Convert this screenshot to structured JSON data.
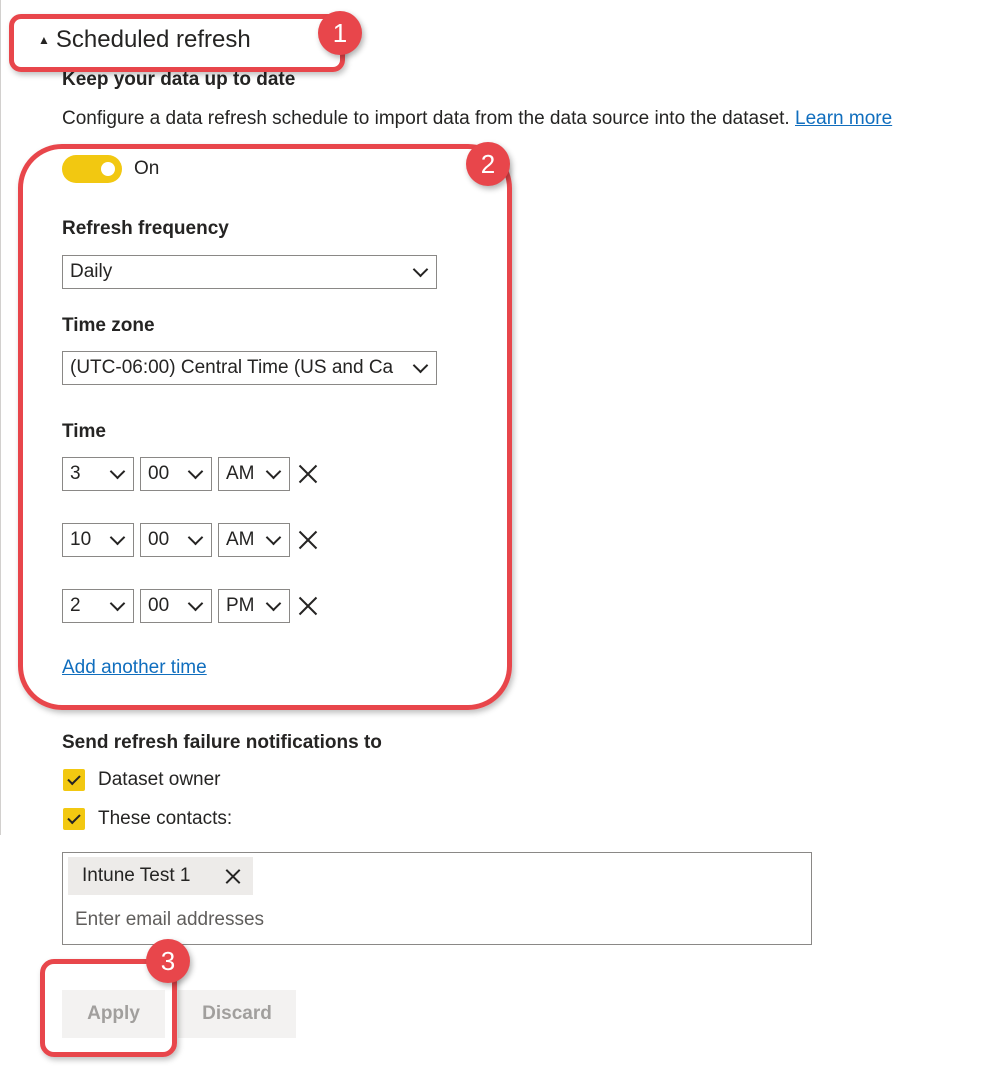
{
  "section": {
    "title": "Scheduled refresh",
    "toggle_glyph": "▲"
  },
  "intro": {
    "heading": "Keep your data up to date",
    "description": "Configure a data refresh schedule to import data from the data source into the dataset.",
    "learn_more": "Learn more"
  },
  "toggle": {
    "state": "On",
    "on": true
  },
  "frequency": {
    "label": "Refresh frequency",
    "value": "Daily"
  },
  "timezone": {
    "label": "Time zone",
    "value": "(UTC-06:00) Central Time (US and Ca"
  },
  "time": {
    "label": "Time",
    "rows": [
      {
        "hour": "3",
        "minute": "00",
        "period": "AM"
      },
      {
        "hour": "10",
        "minute": "00",
        "period": "AM"
      },
      {
        "hour": "2",
        "minute": "00",
        "period": "PM"
      }
    ],
    "add_another": "Add another time"
  },
  "notifications": {
    "label": "Send refresh failure notifications to",
    "dataset_owner": {
      "label": "Dataset owner",
      "checked": true
    },
    "these_contacts": {
      "label": "These contacts:",
      "checked": true
    },
    "contacts": [
      "Intune Test 1"
    ],
    "email_placeholder": "Enter email addresses"
  },
  "buttons": {
    "apply": "Apply",
    "discard": "Discard"
  },
  "callouts": {
    "one": "1",
    "two": "2",
    "three": "3"
  },
  "colors": {
    "accent": "#f2c811",
    "link": "#106ebe",
    "callout": "#e8464b"
  },
  "icons": {
    "section_toggle": "triangle-up-icon",
    "dropdown": "chevron-down-icon",
    "remove": "close-icon",
    "checkbox": "checkmark-icon"
  }
}
